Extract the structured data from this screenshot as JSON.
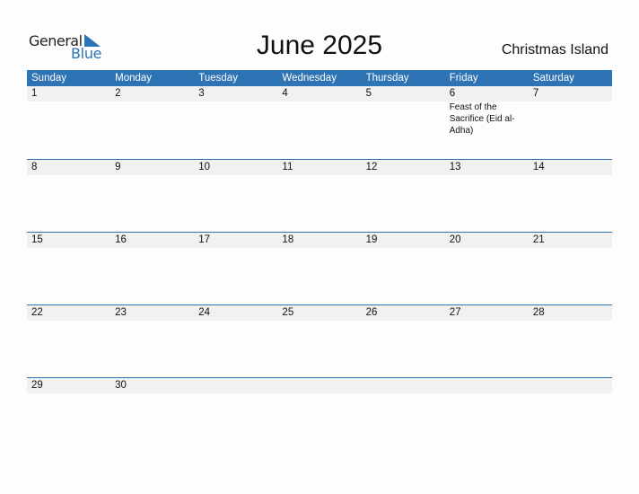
{
  "logo": {
    "general": "General",
    "blue": "Blue"
  },
  "header": {
    "title": "June 2025",
    "region": "Christmas Island"
  },
  "colors": {
    "accent": "#2e73b4",
    "date_strip": "#f1f1f1"
  },
  "weekdays": [
    "Sunday",
    "Monday",
    "Tuesday",
    "Wednesday",
    "Thursday",
    "Friday",
    "Saturday"
  ],
  "weeks": [
    [
      {
        "d": "1"
      },
      {
        "d": "2"
      },
      {
        "d": "3"
      },
      {
        "d": "4"
      },
      {
        "d": "5"
      },
      {
        "d": "6",
        "event": "Feast of the Sacrifice (Eid al-Adha)"
      },
      {
        "d": "7"
      }
    ],
    [
      {
        "d": "8"
      },
      {
        "d": "9"
      },
      {
        "d": "10"
      },
      {
        "d": "11"
      },
      {
        "d": "12"
      },
      {
        "d": "13"
      },
      {
        "d": "14"
      }
    ],
    [
      {
        "d": "15"
      },
      {
        "d": "16"
      },
      {
        "d": "17"
      },
      {
        "d": "18"
      },
      {
        "d": "19"
      },
      {
        "d": "20"
      },
      {
        "d": "21"
      }
    ],
    [
      {
        "d": "22"
      },
      {
        "d": "23"
      },
      {
        "d": "24"
      },
      {
        "d": "25"
      },
      {
        "d": "26"
      },
      {
        "d": "27"
      },
      {
        "d": "28"
      }
    ],
    [
      {
        "d": "29"
      },
      {
        "d": "30"
      },
      {
        "d": ""
      },
      {
        "d": ""
      },
      {
        "d": ""
      },
      {
        "d": ""
      },
      {
        "d": ""
      }
    ]
  ]
}
